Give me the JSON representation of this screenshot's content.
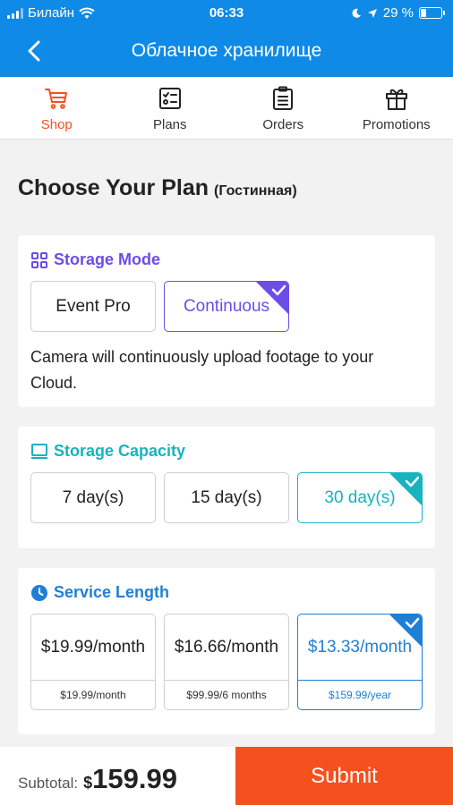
{
  "status_bar": {
    "carrier": "Билайн",
    "time": "06:33",
    "battery": "29 %",
    "battery_level": 0.29
  },
  "header": {
    "title": "Облачное хранилище"
  },
  "tabs": [
    {
      "label": "Shop",
      "icon": "cart-icon",
      "active": true
    },
    {
      "label": "Plans",
      "icon": "checklist-icon",
      "active": false
    },
    {
      "label": "Orders",
      "icon": "clipboard-icon",
      "active": false
    },
    {
      "label": "Promotions",
      "icon": "gift-icon",
      "active": false
    }
  ],
  "page": {
    "heading": "Choose Your Plan",
    "room": "(Гостинная)"
  },
  "storage_mode": {
    "title": "Storage Mode",
    "options": [
      "Event Pro",
      "Continuous"
    ],
    "selected": "Continuous",
    "description": "Camera will continuously upload footage to your Cloud."
  },
  "storage_capacity": {
    "title": "Storage Capacity",
    "options": [
      "7 day(s)",
      "15 day(s)",
      "30 day(s)"
    ],
    "selected": "30 day(s)"
  },
  "service_length": {
    "title": "Service Length",
    "options": [
      {
        "price": "$19.99/month",
        "total": "$19.99/month"
      },
      {
        "price": "$16.66/month",
        "total": "$99.99/6 months"
      },
      {
        "price": "$13.33/month",
        "total": "$159.99/year"
      }
    ],
    "selected_index": 2
  },
  "footer": {
    "subtotal_label": "Subtotal:",
    "currency": "$",
    "amount": "159.99",
    "submit_label": "Submit"
  },
  "colors": {
    "header_blue": "#0f8ae6",
    "active_orange": "#f4511e",
    "mode_purple": "#6c4de6",
    "capacity_teal": "#17b3bf",
    "length_blue": "#1f7fd6"
  }
}
